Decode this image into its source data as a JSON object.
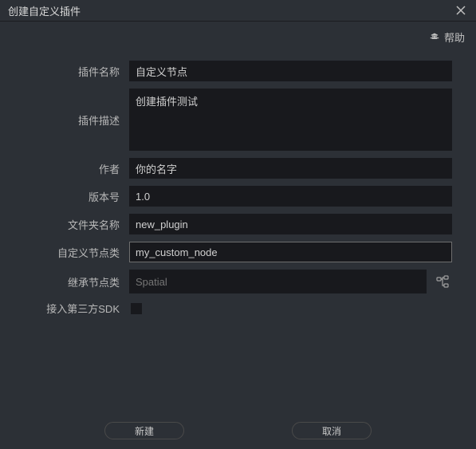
{
  "title": "创建自定义插件",
  "help": "帮助",
  "labels": {
    "pluginName": "插件名称",
    "pluginDesc": "插件描述",
    "author": "作者",
    "version": "版本号",
    "folderName": "文件夹名称",
    "customNodeClass": "自定义节点类",
    "inheritNodeClass": "继承节点类",
    "thirdPartySDK": "接入第三方SDK"
  },
  "values": {
    "pluginName": "自定义节点",
    "pluginDesc": "创建插件测试",
    "author": "你的名字",
    "version": "1.0",
    "folderName": "new_plugin",
    "customNodeClass": "my_custom_node",
    "inheritNodeClass": "Spatial"
  },
  "buttons": {
    "create": "新建",
    "cancel": "取消"
  }
}
